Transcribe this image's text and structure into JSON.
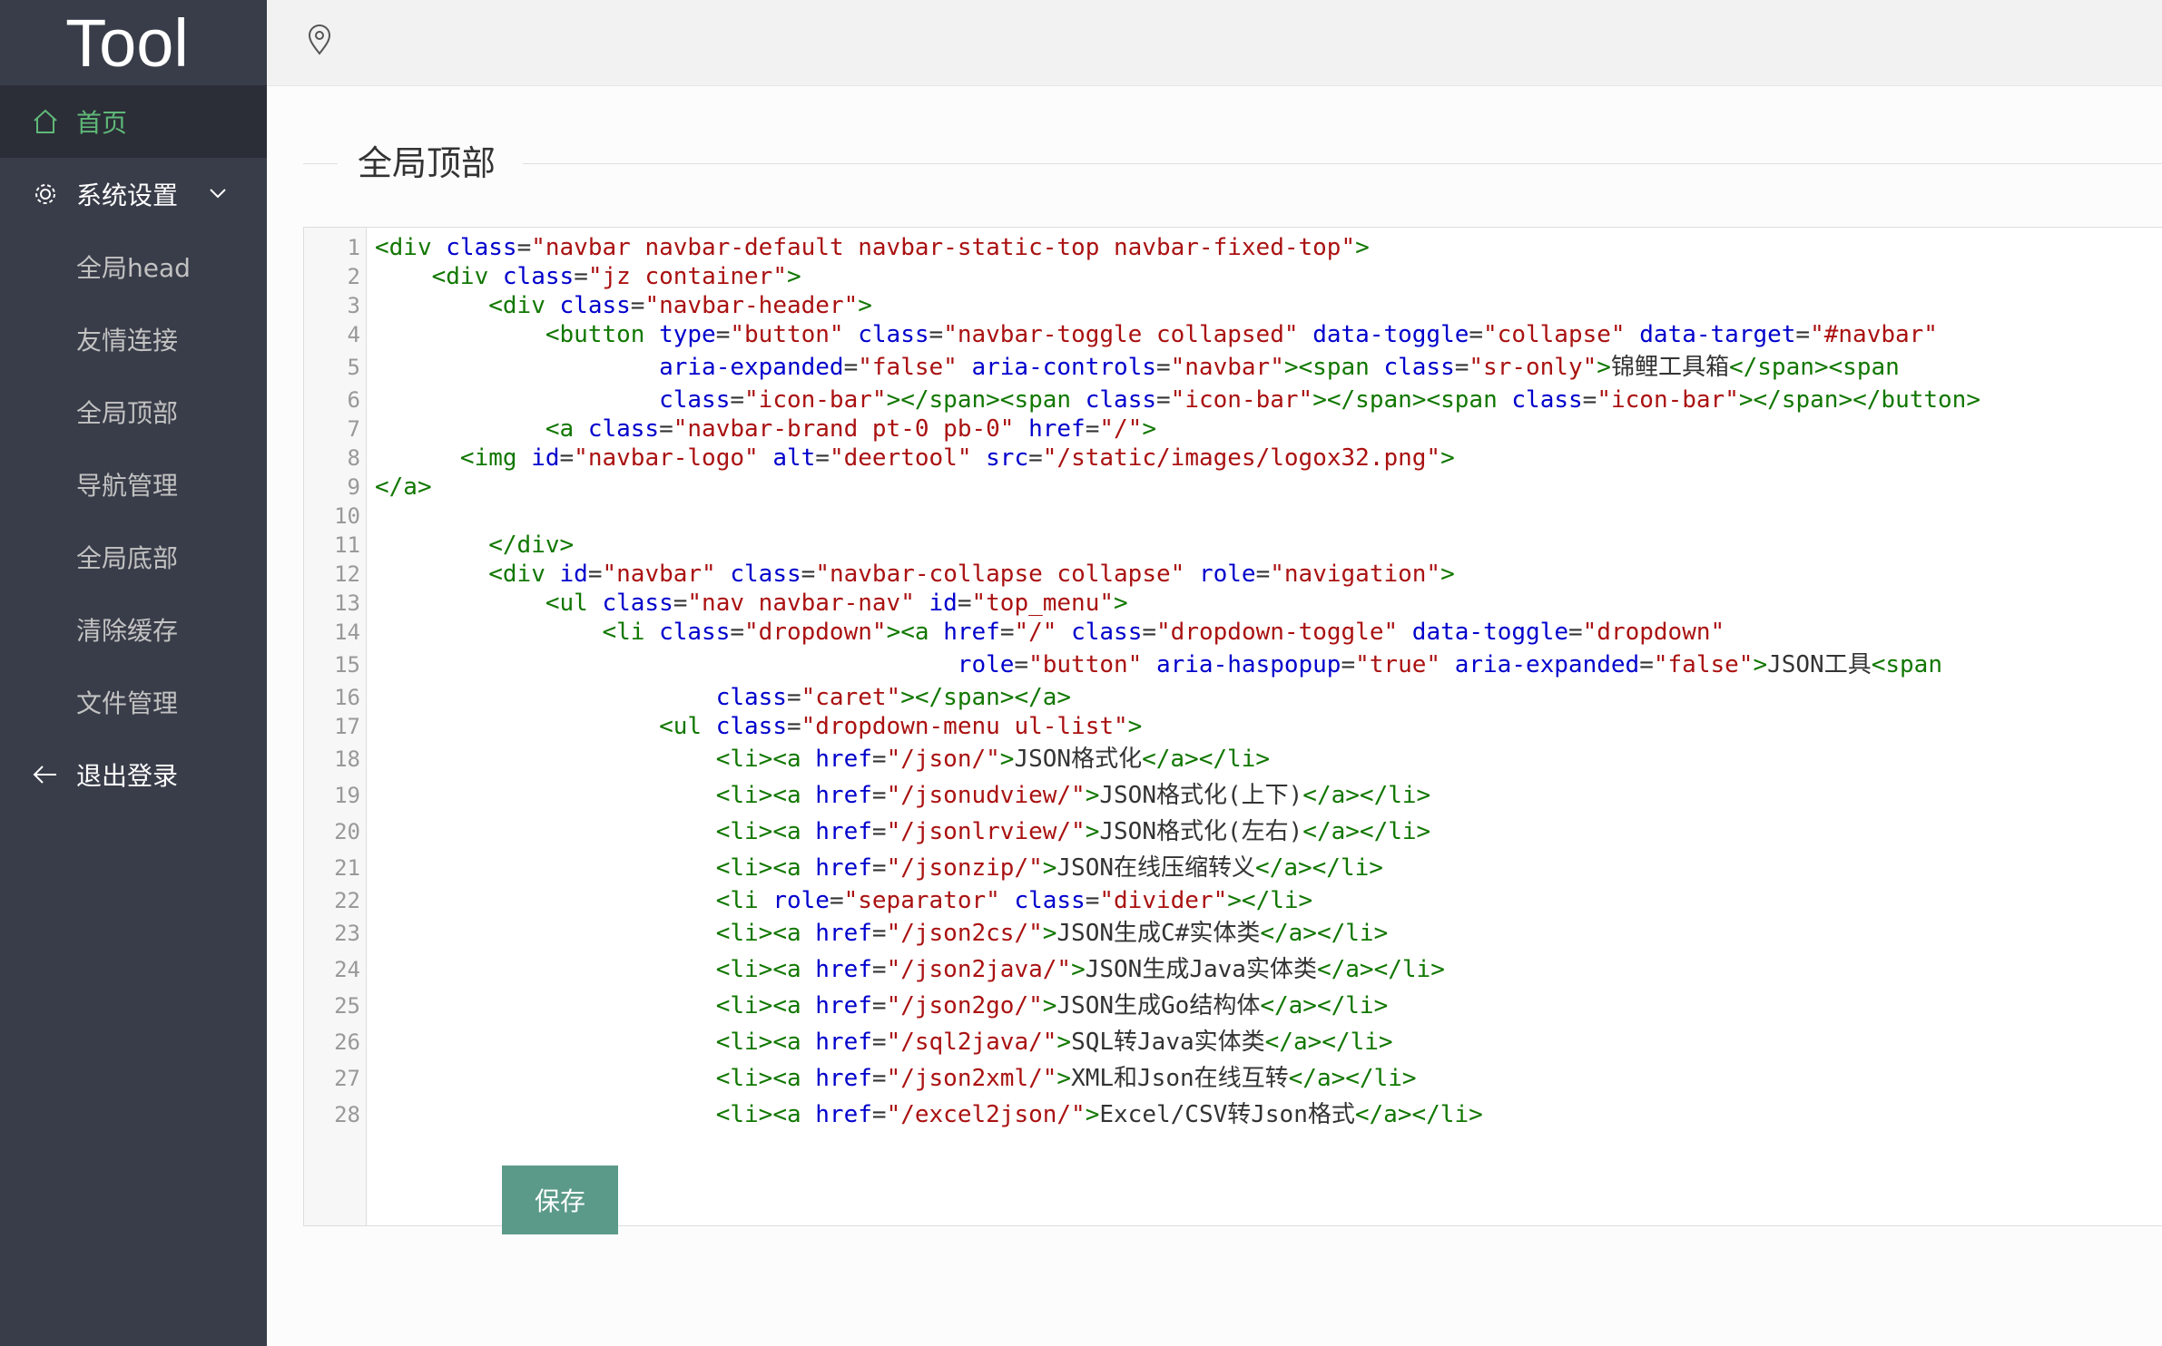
{
  "brand": "Tool",
  "sidebar": {
    "home": "首页",
    "settings": "系统设置",
    "sub_items": [
      "全局head",
      "友情连接",
      "全局顶部",
      "导航管理",
      "全局底部",
      "清除缓存",
      "文件管理"
    ],
    "logout": "退出登录"
  },
  "page": {
    "legend": "全局顶部",
    "save_label": "保存"
  },
  "colors": {
    "sidebar_bg": "#393d49",
    "active_bg": "#2b2e37",
    "active_text": "#5fb878",
    "save_button": "#5b9a88"
  },
  "code_lines": [
    "<div class=\"navbar navbar-default navbar-static-top navbar-fixed-top\">",
    "    <div class=\"jz container\">",
    "        <div class=\"navbar-header\">",
    "            <button type=\"button\" class=\"navbar-toggle collapsed\" data-toggle=\"collapse\" data-target=\"#navbar\"",
    "                    aria-expanded=\"false\" aria-controls=\"navbar\"><span class=\"sr-only\">锦鲤工具箱</span><span",
    "                    class=\"icon-bar\"></span><span class=\"icon-bar\"></span><span class=\"icon-bar\"></span></button>",
    "            <a class=\"navbar-brand pt-0 pb-0\" href=\"/\">",
    "      <img id=\"navbar-logo\" alt=\"deertool\" src=\"/static/images/logox32.png\">",
    "</a>",
    "",
    "        </div>",
    "        <div id=\"navbar\" class=\"navbar-collapse collapse\" role=\"navigation\">",
    "            <ul class=\"nav navbar-nav\" id=\"top_menu\">",
    "                <li class=\"dropdown\"><a href=\"/\" class=\"dropdown-toggle\" data-toggle=\"dropdown\"",
    "                                         role=\"button\" aria-haspopup=\"true\" aria-expanded=\"false\">JSON工具<span",
    "                        class=\"caret\"></span></a>",
    "                    <ul class=\"dropdown-menu ul-list\">",
    "                        <li><a href=\"/json/\">JSON格式化</a></li>",
    "                        <li><a href=\"/jsonudview/\">JSON格式化(上下)</a></li>",
    "                        <li><a href=\"/jsonlrview/\">JSON格式化(左右)</a></li>",
    "                        <li><a href=\"/jsonzip/\">JSON在线压缩转义</a></li>",
    "                        <li role=\"separator\" class=\"divider\"></li>",
    "                        <li><a href=\"/json2cs/\">JSON生成C#实体类</a></li>",
    "                        <li><a href=\"/json2java/\">JSON生成Java实体类</a></li>",
    "                        <li><a href=\"/json2go/\">JSON生成Go结构体</a></li>",
    "                        <li><a href=\"/sql2java/\">SQL转Java实体类</a></li>",
    "                        <li><a href=\"/json2xml/\">XML和Json在线互转</a></li>",
    "                        <li><a href=\"/excel2json/\">Excel/CSV转Json格式</a></li>"
  ]
}
